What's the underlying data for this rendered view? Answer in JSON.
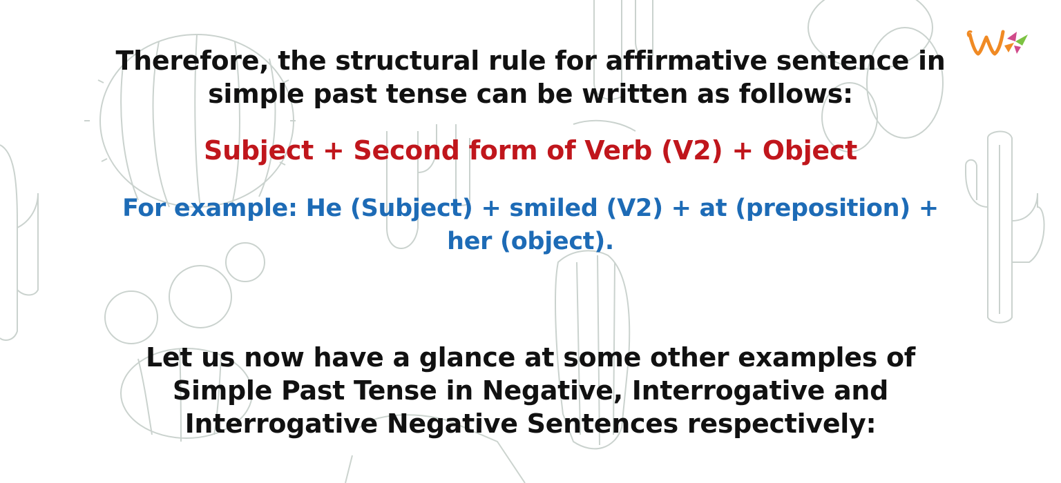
{
  "intro": {
    "line1": "Therefore, the structural rule for affirmative sentence in",
    "line2": "simple past tense can be written as follows:"
  },
  "formula": "Subject + Second form of Verb (V2) + Object",
  "example": {
    "line1": "For example: He (Subject) + smiled (V2) + at (preposition) +",
    "line2": "her (object)."
  },
  "outro": {
    "line1": "Let us now have a glance at some other examples of",
    "line2": "Simple Past Tense in Negative, Interrogative and",
    "line3": "Interrogative Negative Sentences respectively:"
  },
  "colors": {
    "text": "#111111",
    "formula": "#c0161c",
    "example": "#1d6bb6",
    "cactus": "#b9c4be",
    "logo_orange": "#f08a24",
    "logo_green": "#7cc242",
    "logo_pink": "#d04a8a"
  },
  "icons": {
    "logo": "w-logo-icon",
    "background": "cactus-pattern"
  }
}
